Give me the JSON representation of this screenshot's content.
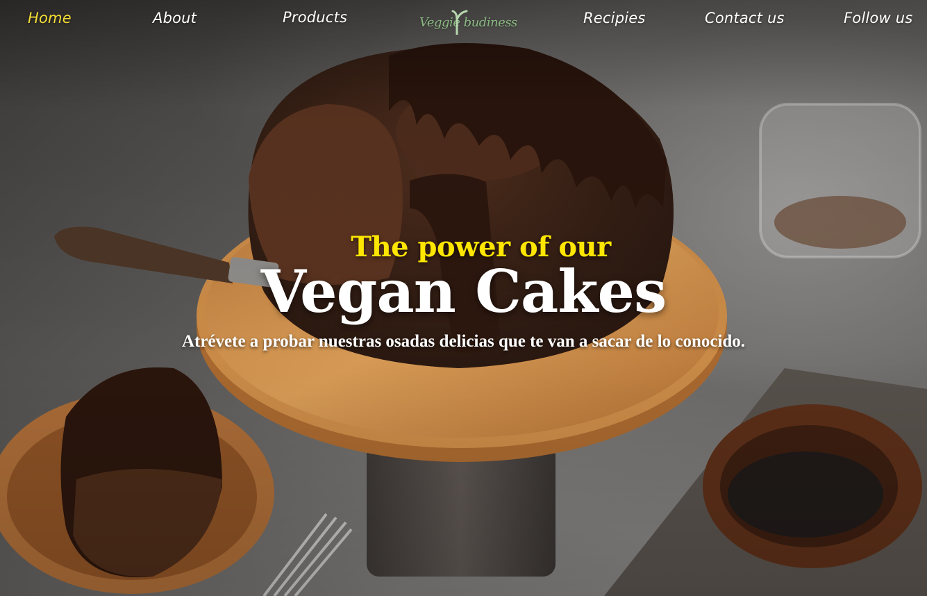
{
  "nav": {
    "items": [
      {
        "label": "Home",
        "active": true
      },
      {
        "label": "About",
        "active": false
      },
      {
        "label": "Products",
        "active": false
      },
      {
        "label": "Recipies",
        "active": false
      },
      {
        "label": "Contact us",
        "active": false
      },
      {
        "label": "Follow us",
        "active": false
      }
    ],
    "active_color": "#f4dd35"
  },
  "logo": {
    "text": "Veggie budiness",
    "color": "#8bb982"
  },
  "hero": {
    "kicker": "The power of our",
    "title": "Vegan Cakes",
    "subtitle": "Atrévete a probar nuestras osadas delicias que te van a sacar de lo conocido.",
    "kicker_color": "#ffe600",
    "title_color": "#ffffff"
  },
  "background": {
    "description_icon": "chocolate-bundt-cake-photo"
  }
}
